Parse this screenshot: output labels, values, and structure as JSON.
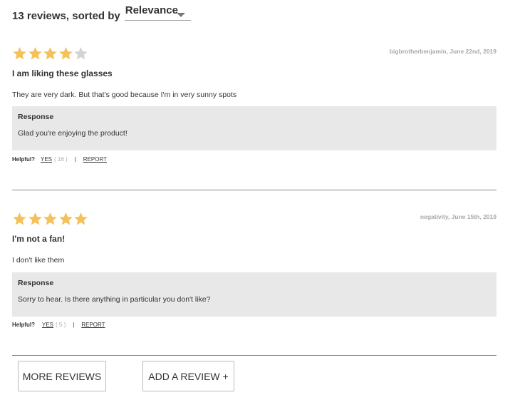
{
  "header": {
    "count_text": "13 reviews, sorted by",
    "sort_value": "Relevance"
  },
  "reviews": [
    {
      "rating": 4,
      "max_rating": 5,
      "author_date": "bigbrotherbenjamin, June 22nd, 2019",
      "title": "I am liking these glasses",
      "body": "They are very dark. But that's good because I'm in very sunny spots",
      "response_label": "Response",
      "response_text": "Glad you're enjoying the product!",
      "helpful_label": "Helpful?",
      "yes_label": "YES",
      "yes_count": "( 16 )",
      "separator": "|",
      "report_label": "REPORT"
    },
    {
      "rating": 5,
      "max_rating": 5,
      "author_date": "negativity, June 15th, 2019",
      "title": "I'm not a fan!",
      "body": "I don't like them",
      "response_label": "Response",
      "response_text": "Sorry to hear. Is there anything in particular you don't like?",
      "helpful_label": "Helpful?",
      "yes_label": "YES",
      "yes_count": "( 5 )",
      "separator": "|",
      "report_label": "REPORT"
    }
  ],
  "buttons": {
    "more_reviews": "MORE REVIEWS",
    "add_review": "ADD A REVIEW +"
  },
  "colors": {
    "star_filled": "#f5c15a",
    "star_empty": "#d3d3d3",
    "response_bg": "#e8e8e8"
  }
}
